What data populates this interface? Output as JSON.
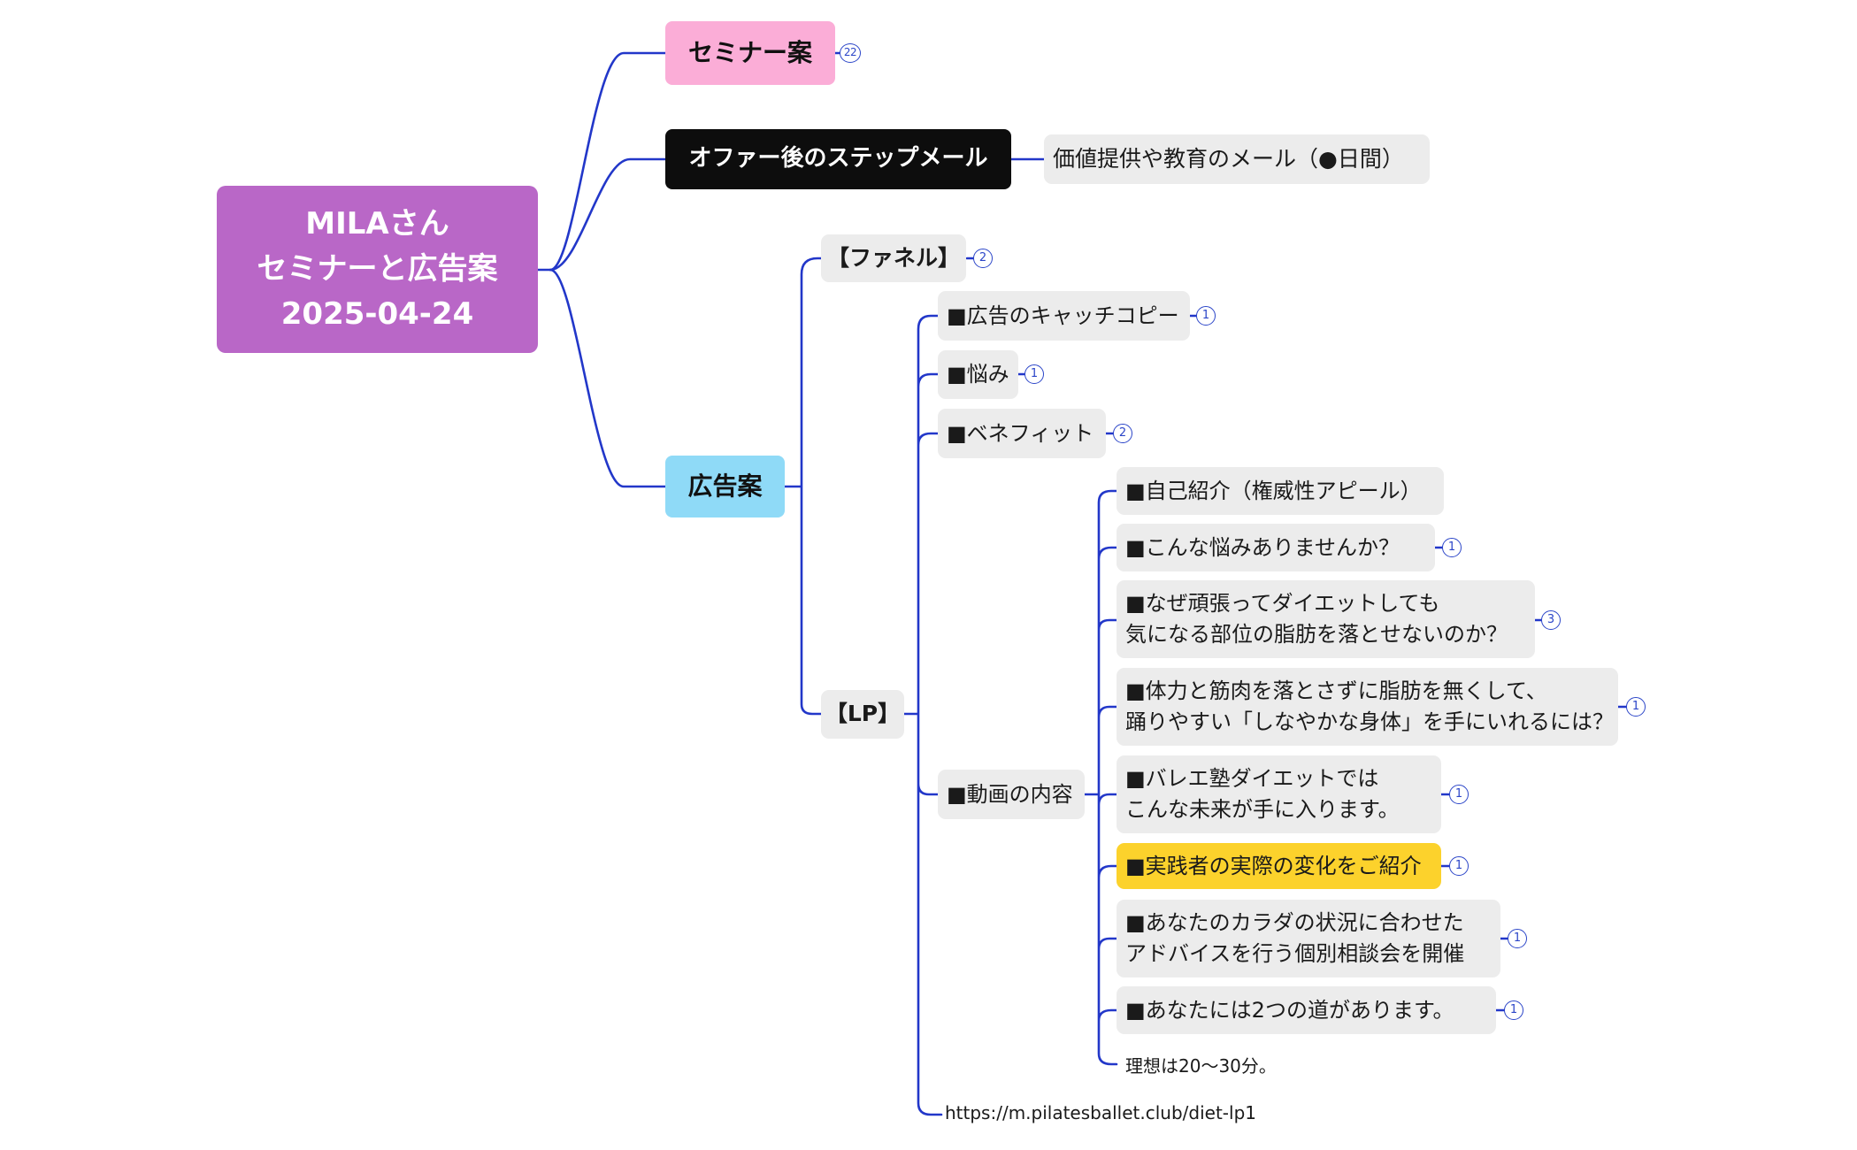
{
  "root": {
    "line1": "MILAさん",
    "line2": "セミナーと広告案",
    "line3": "2025-04-24"
  },
  "seminar": {
    "label": "セミナー案",
    "count": "22"
  },
  "step_mail": {
    "label": "オファー後のステップメール",
    "child": "価値提供や教育のメール（●日間）"
  },
  "ad_plan": {
    "label": "広告案",
    "funnel": {
      "label": "【ファネル】",
      "count": "2"
    },
    "lp": {
      "label": "【LP】",
      "catchcopy": {
        "label": "■広告のキャッチコピー",
        "count": "1"
      },
      "worry": {
        "label": "■悩み",
        "count": "1"
      },
      "benefit": {
        "label": "■ベネフィット",
        "count": "2"
      },
      "video": {
        "label": "■動画の内容",
        "items": [
          {
            "text": "■自己紹介（権威性アピール）"
          },
          {
            "text": "■こんな悩みありませんか？",
            "count": "1"
          },
          {
            "line1": "■なぜ頑張ってダイエットしても",
            "line2": "気になる部位の脂肪を落とせないのか？",
            "count": "3"
          },
          {
            "line1": "■体力と筋肉を落とさずに脂肪を無くして、",
            "line2": "踊りやすい「しなやかな身体」を手にいれるには？",
            "count": "1"
          },
          {
            "line1": "■バレエ塾ダイエットでは",
            "line2": "こんな未来が手に入ります。",
            "count": "1"
          },
          {
            "text": "■実践者の実際の変化をご紹介",
            "count": "1"
          },
          {
            "line1": "■あなたのカラダの状況に合わせた",
            "line2": "アドバイスを行う個別相談会を開催",
            "count": "1"
          },
          {
            "text": "■あなたには2つの道があります。",
            "count": "1"
          },
          {
            "text": "理想は20〜30分。"
          }
        ]
      },
      "url": "https://m.pilatesballet.club/diet-lp1"
    }
  },
  "colors": {
    "connector": "#2237c9",
    "root": "#b967c7",
    "seminar": "#fbadd7",
    "step_mail": "#0d0d0d",
    "ad_plan": "#8fdaf7",
    "highlight": "#fcd22c",
    "topic": "#ececec"
  }
}
